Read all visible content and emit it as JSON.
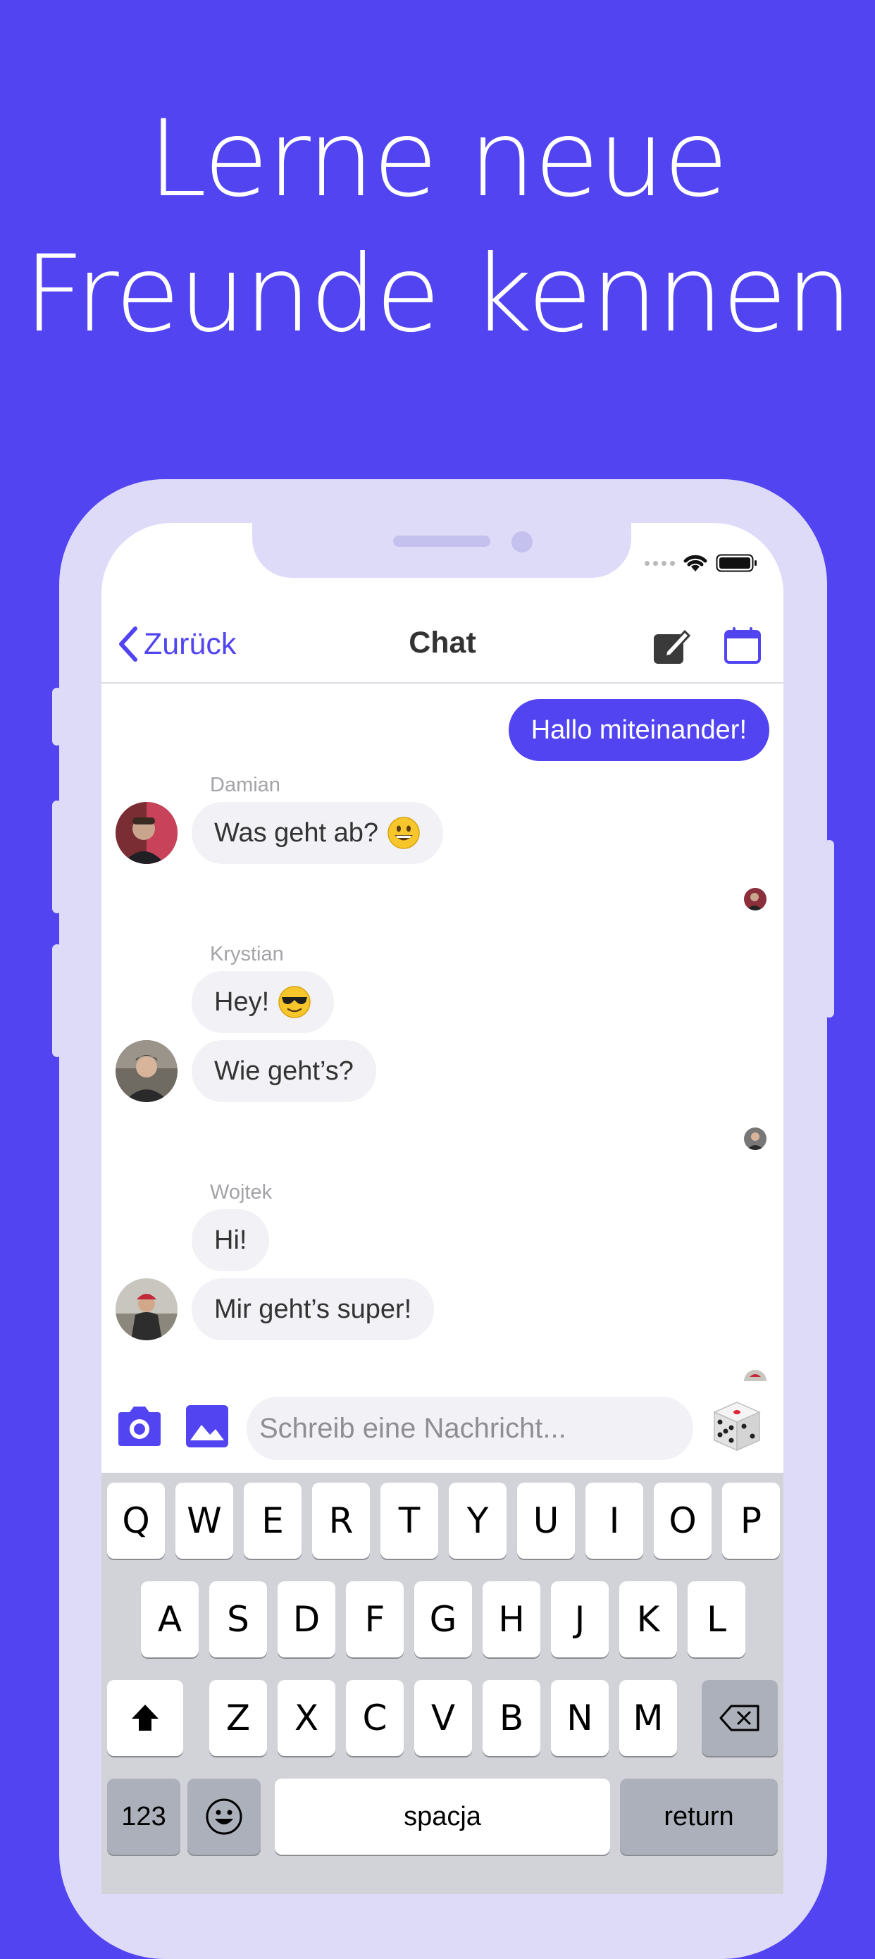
{
  "headline": {
    "line1": "Lerne neue",
    "line2": "Freunde kennen"
  },
  "colors": {
    "accent": "#5245f1",
    "frame": "#dedbf9",
    "bubble_in": "#f1f1f6",
    "keyboard": "#d1d3d9"
  },
  "status_bar": {
    "icons": [
      "signal-dots-icon",
      "wifi-icon",
      "battery-icon"
    ]
  },
  "navbar": {
    "back_label": "Zurück",
    "title": "Chat",
    "icons": [
      "compose-icon",
      "calendar-icon"
    ]
  },
  "chat": {
    "outgoing": {
      "text": "Hallo miteinander!"
    },
    "groups": [
      {
        "sender": "Damian",
        "messages": [
          {
            "text": "Was geht ab?",
            "emoji": "grinning-face"
          }
        ]
      },
      {
        "sender": "Krystian",
        "messages": [
          {
            "text": "Hey!",
            "emoji": "sunglasses-face"
          },
          {
            "text": "Wie geht’s?"
          }
        ]
      },
      {
        "sender": "Wojtek",
        "messages": [
          {
            "text": "Hi!"
          },
          {
            "text": "Mir geht’s super!"
          }
        ]
      }
    ]
  },
  "composer": {
    "placeholder": "Schreib eine Nachricht...",
    "icons": [
      "camera-icon",
      "photo-library-icon",
      "dice-icon"
    ]
  },
  "keyboard": {
    "row1": [
      "Q",
      "W",
      "E",
      "R",
      "T",
      "Y",
      "U",
      "I",
      "O",
      "P"
    ],
    "row2": [
      "A",
      "S",
      "D",
      "F",
      "G",
      "H",
      "J",
      "K",
      "L"
    ],
    "row3": [
      "Z",
      "X",
      "C",
      "V",
      "B",
      "N",
      "M"
    ],
    "numbers_label": "123",
    "space_label": "spacja",
    "return_label": "return"
  }
}
